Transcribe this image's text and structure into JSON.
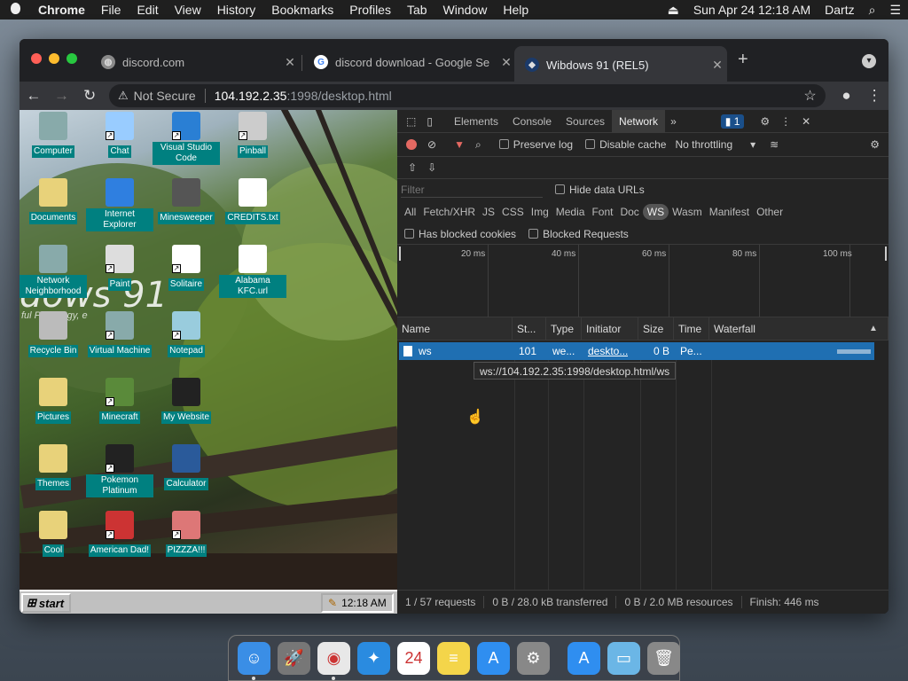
{
  "menubar": {
    "app": "Chrome",
    "items": [
      "File",
      "Edit",
      "View",
      "History",
      "Bookmarks",
      "Profiles",
      "Tab",
      "Window",
      "Help"
    ],
    "datetime": "Sun Apr 24  12:18 AM",
    "user": "Dartz"
  },
  "browser": {
    "tabs": [
      {
        "title": "discord.com",
        "favicon": "globe-icon",
        "active": false
      },
      {
        "title": "discord download - Google Se",
        "favicon": "google-icon",
        "active": false
      },
      {
        "title": "Wibdows 91 (REL5)",
        "favicon": "app-icon",
        "active": true
      }
    ],
    "address": {
      "security": "Not Secure",
      "host": "104.192.2.35",
      "path": ":1998/desktop.html"
    }
  },
  "desktop": {
    "watermark": "dows 91",
    "watermark_sub": "ful P    hnology, e",
    "icons": [
      {
        "label": "Computer",
        "col": 0,
        "row": 0,
        "icon": "computer-icon",
        "shortcut": false,
        "color": "#8aa"
      },
      {
        "label": "Chat",
        "col": 1,
        "row": 0,
        "icon": "chat-icon",
        "shortcut": true,
        "color": "#9cf"
      },
      {
        "label": "Visual Studio Code",
        "col": 2,
        "row": 0,
        "icon": "vscode-icon",
        "shortcut": true,
        "color": "#2a7fd4"
      },
      {
        "label": "Pinball",
        "col": 3,
        "row": 0,
        "icon": "pinball-icon",
        "shortcut": true,
        "color": "#ccc"
      },
      {
        "label": "Documents",
        "col": 0,
        "row": 1,
        "icon": "folder-icon",
        "shortcut": false,
        "color": "#e8d27a"
      },
      {
        "label": "Internet Explorer",
        "col": 1,
        "row": 1,
        "icon": "ie-icon",
        "shortcut": false,
        "color": "#2f7fe0"
      },
      {
        "label": "Minesweeper",
        "col": 2,
        "row": 1,
        "icon": "mine-icon",
        "shortcut": false,
        "color": "#555"
      },
      {
        "label": "CREDITS.txt",
        "col": 3,
        "row": 1,
        "icon": "text-file-icon",
        "shortcut": false,
        "color": "#fff"
      },
      {
        "label": "Network Neighborhood",
        "col": 0,
        "row": 2,
        "icon": "network-icon",
        "shortcut": false,
        "color": "#8aa"
      },
      {
        "label": "Paint",
        "col": 1,
        "row": 2,
        "icon": "paint-icon",
        "shortcut": true,
        "color": "#ddd"
      },
      {
        "label": "Solitaire",
        "col": 2,
        "row": 2,
        "icon": "solitaire-icon",
        "shortcut": true,
        "color": "#fff"
      },
      {
        "label": "Alabama KFC.url",
        "col": 3,
        "row": 2,
        "icon": "ie-icon",
        "shortcut": false,
        "color": "#fff"
      },
      {
        "label": "Recycle Bin",
        "col": 0,
        "row": 3,
        "icon": "recycle-bin-icon",
        "shortcut": false,
        "color": "#bbb"
      },
      {
        "label": "Virtual Machine",
        "col": 1,
        "row": 3,
        "icon": "computer-icon",
        "shortcut": true,
        "color": "#8aa"
      },
      {
        "label": "Notepad",
        "col": 2,
        "row": 3,
        "icon": "notepad-icon",
        "shortcut": true,
        "color": "#9cd"
      },
      {
        "label": "Pictures",
        "col": 0,
        "row": 4,
        "icon": "folder-icon",
        "shortcut": false,
        "color": "#e8d27a"
      },
      {
        "label": "Minecraft",
        "col": 1,
        "row": 4,
        "icon": "minecraft-icon",
        "shortcut": true,
        "color": "#5a8a3a"
      },
      {
        "label": "My Website",
        "col": 2,
        "row": 4,
        "icon": "github-icon",
        "shortcut": false,
        "color": "#222"
      },
      {
        "label": "Themes",
        "col": 0,
        "row": 5,
        "icon": "folder-icon",
        "shortcut": false,
        "color": "#e8d27a"
      },
      {
        "label": "Pokemon Platinum",
        "col": 1,
        "row": 5,
        "icon": "pokemon-icon",
        "shortcut": true,
        "color": "#222"
      },
      {
        "label": "Calculator",
        "col": 2,
        "row": 5,
        "icon": "calculator-icon",
        "shortcut": false,
        "color": "#2a5a9a"
      },
      {
        "label": "Cool",
        "col": 0,
        "row": 6,
        "icon": "folder-icon",
        "shortcut": false,
        "color": "#e8d27a"
      },
      {
        "label": "American Dad!",
        "col": 1,
        "row": 6,
        "icon": "flag-icon",
        "shortcut": true,
        "color": "#c33"
      },
      {
        "label": "PIZZZA!!!",
        "col": 2,
        "row": 6,
        "icon": "pizza-icon",
        "shortcut": true,
        "color": "#d77"
      }
    ],
    "taskbar": {
      "start": "start",
      "clock": "12:18 AM"
    }
  },
  "devtools": {
    "tabs": [
      "Elements",
      "Console",
      "Sources",
      "Network"
    ],
    "active_tab": "Network",
    "more": "»",
    "message_count": "1",
    "toolbar": {
      "preserve_log": "Preserve log",
      "disable_cache": "Disable cache",
      "throttling": "No throttling"
    },
    "filter": {
      "placeholder": "Filter",
      "hide_data_urls": "Hide data URLs"
    },
    "type_filters": [
      "All",
      "Fetch/XHR",
      "JS",
      "CSS",
      "Img",
      "Media",
      "Font",
      "Doc",
      "WS",
      "Wasm",
      "Manifest",
      "Other"
    ],
    "active_type": "WS",
    "blocked": {
      "cookies": "Has blocked cookies",
      "requests": "Blocked Requests"
    },
    "timeline_ticks": [
      "20 ms",
      "40 ms",
      "60 ms",
      "80 ms",
      "100 ms"
    ],
    "columns": [
      "Name",
      "St...",
      "Type",
      "Initiator",
      "Size",
      "Time",
      "Waterfall"
    ],
    "row": {
      "name": "ws",
      "status": "101",
      "type": "we...",
      "initiator": "deskto...",
      "size": "0 B",
      "time": "Pe..."
    },
    "tooltip": "ws://104.192.2.35:1998/desktop.html/ws",
    "status": {
      "requests": "1 / 57 requests",
      "transferred": "0 B / 28.0 kB transferred",
      "resources": "0 B / 2.0 MB resources",
      "finish": "Finish: 446 ms"
    }
  },
  "dock": {
    "apps": [
      {
        "name": "Finder",
        "icon": "finder-icon",
        "glyph": "☺",
        "color": "#3a8ee6",
        "running": true
      },
      {
        "name": "Launchpad",
        "icon": "launchpad-icon",
        "glyph": "🚀",
        "color": "#777",
        "running": false
      },
      {
        "name": "Chrome",
        "icon": "chrome-icon",
        "glyph": "◉",
        "color": "#e8e8e8",
        "running": true
      },
      {
        "name": "Safari",
        "icon": "safari-icon",
        "glyph": "✦",
        "color": "#2a8be0",
        "running": false
      },
      {
        "name": "Calendar",
        "icon": "calendar-icon",
        "glyph": "24",
        "color": "#fff",
        "running": false
      },
      {
        "name": "Notes",
        "icon": "notes-icon",
        "glyph": "≡",
        "color": "#f4d54a",
        "running": false
      },
      {
        "name": "App Store",
        "icon": "app-store-icon",
        "glyph": "A",
        "color": "#2f8ef0",
        "running": false
      },
      {
        "name": "System Preferences",
        "icon": "gear-icon",
        "glyph": "⚙",
        "color": "#888",
        "running": false
      }
    ],
    "after_sep": [
      {
        "name": "App Store",
        "icon": "app-store-icon",
        "glyph": "A",
        "color": "#2f8ef0"
      },
      {
        "name": "Downloads",
        "icon": "folder-icon",
        "glyph": "▭",
        "color": "#6bb6e6"
      },
      {
        "name": "Trash",
        "icon": "trash-icon",
        "glyph": "🗑",
        "color": "#888"
      }
    ]
  }
}
